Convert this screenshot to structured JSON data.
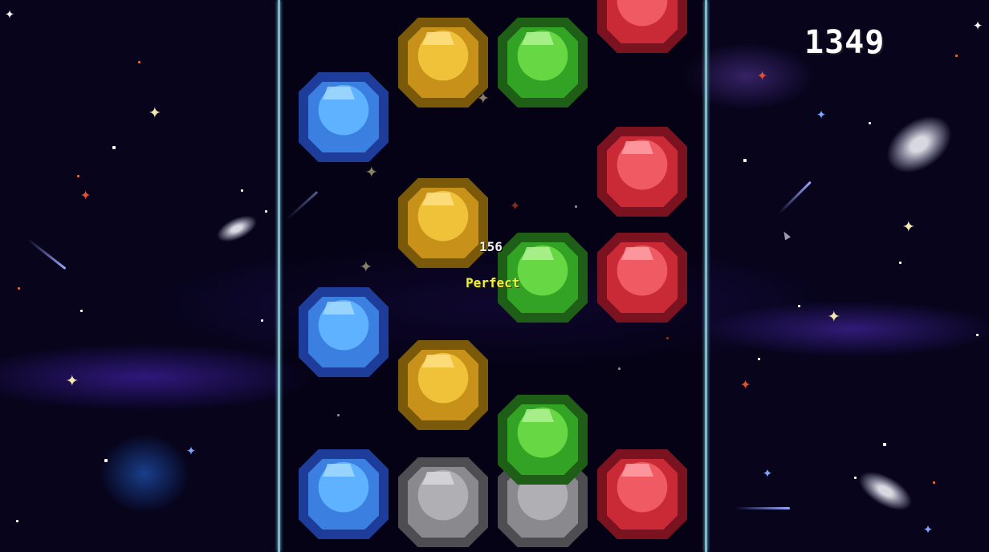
{
  "hud": {
    "score": "1349",
    "combo": "156",
    "judgement": "Perfect"
  },
  "colors": {
    "lane_border": "#7fb8c8",
    "judgement_perfect": "#f0f036",
    "note_blue": "#3b7fe0",
    "note_yellow": "#c8921a",
    "note_green": "#33a326",
    "note_red": "#c92a36",
    "receptor_gray": "#8a8a8e"
  },
  "icons": [
    "sparkle-star-icon",
    "comet-icon",
    "galaxy-icon",
    "cursor-arrow-icon"
  ],
  "lanes": [
    {
      "lane": 1,
      "color": "blue",
      "notes": 3,
      "receptor": "blue"
    },
    {
      "lane": 2,
      "color": "yellow",
      "notes": 3,
      "receptor": "gray"
    },
    {
      "lane": 3,
      "color": "green",
      "notes": 3,
      "receptor": "gray"
    },
    {
      "lane": 4,
      "color": "red",
      "notes": 4,
      "receptor": "red"
    }
  ]
}
